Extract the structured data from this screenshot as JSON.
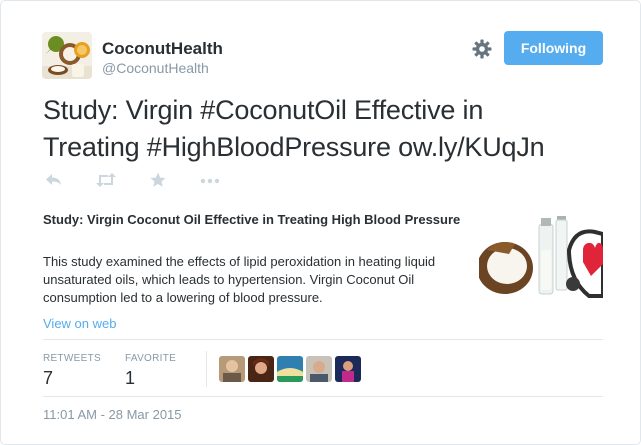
{
  "author": {
    "name": "CoconutHealth",
    "handle": "@CoconutHealth"
  },
  "follow_button": {
    "label": "Following"
  },
  "tweet": {
    "line1": "Study: Virgin #CoconutOil Effective in",
    "line2": "Treating #HighBloodPressure ow.ly/KUqJn"
  },
  "actions": {
    "reply_icon": "reply-icon",
    "retweet_icon": "retweet-icon",
    "favorite_icon": "star-icon",
    "more_icon": "more-icon"
  },
  "card": {
    "title": "Study: Virgin Coconut Oil Effective in Treating High Blood Pressure",
    "description": "This study examined the effects of lipid peroxidation in heating liquid unsaturated oils, which leads to hypertension. Virgin Coconut Oil consumption led to a lowering of blood pressure."
  },
  "view_on_web": "View on web",
  "stats": {
    "retweets_label": "RETWEETS",
    "retweets_value": "7",
    "favorites_label": "FAVORITE",
    "favorites_value": "1"
  },
  "timestamp": "11:01 AM - 28 Mar 2015",
  "colors": {
    "accent": "#55acee",
    "text": "#292f33",
    "muted": "#8899a6",
    "divider": "#e1e8ed"
  }
}
